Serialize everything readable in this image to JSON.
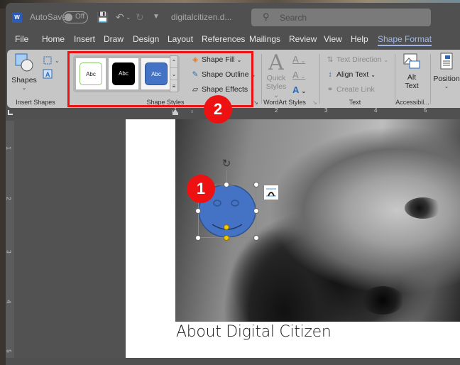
{
  "titlebar": {
    "app_icon": "word-icon",
    "autosave_label": "AutoSave",
    "autosave_state": "Off",
    "document_name": "digitalcitizen.d...",
    "search_placeholder": "Search"
  },
  "menu": {
    "tabs": [
      {
        "label": "File"
      },
      {
        "label": "Home"
      },
      {
        "label": "Insert"
      },
      {
        "label": "Draw"
      },
      {
        "label": "Design"
      },
      {
        "label": "Layout"
      },
      {
        "label": "References"
      },
      {
        "label": "Mailings"
      },
      {
        "label": "Review"
      },
      {
        "label": "View"
      },
      {
        "label": "Help"
      },
      {
        "label": "Shape Format",
        "active": true
      }
    ]
  },
  "ribbon": {
    "insert_shapes": {
      "shapes_label": "Shapes",
      "group_label": "Insert Shapes"
    },
    "shape_styles": {
      "thumbs": [
        {
          "text": "Abc",
          "style": "white-green-outline"
        },
        {
          "text": "Abc",
          "style": "black"
        },
        {
          "text": "Abc",
          "style": "blue"
        }
      ],
      "shape_fill": "Shape Fill",
      "shape_outline": "Shape Outline",
      "shape_effects": "Shape Effects",
      "group_label": "Shape Styles"
    },
    "wordart_styles": {
      "quick_styles_line1": "Quick",
      "quick_styles_line2": "Styles",
      "group_label": "WordArt Styles"
    },
    "text": {
      "text_direction": "Text Direction",
      "align_text": "Align Text",
      "create_link": "Create Link",
      "group_label": "Text"
    },
    "accessibility": {
      "alt_text_line1": "Alt",
      "alt_text_line2": "Text",
      "group_label": "Accessibil..."
    },
    "arrange": {
      "position": "Position"
    }
  },
  "annotations": {
    "badge_1": "1",
    "badge_2": "2",
    "highlight_color": "#ee1111"
  },
  "ruler": {
    "h_numbers": [
      "1",
      "2",
      "3",
      "4",
      "5"
    ],
    "v_numbers": [
      "1",
      "2",
      "3",
      "4",
      "5"
    ]
  },
  "document": {
    "heading": "About Digital Citizen"
  },
  "shape": {
    "type": "smiley-face",
    "fill": "#4472c4",
    "outline": "#2f528f"
  }
}
